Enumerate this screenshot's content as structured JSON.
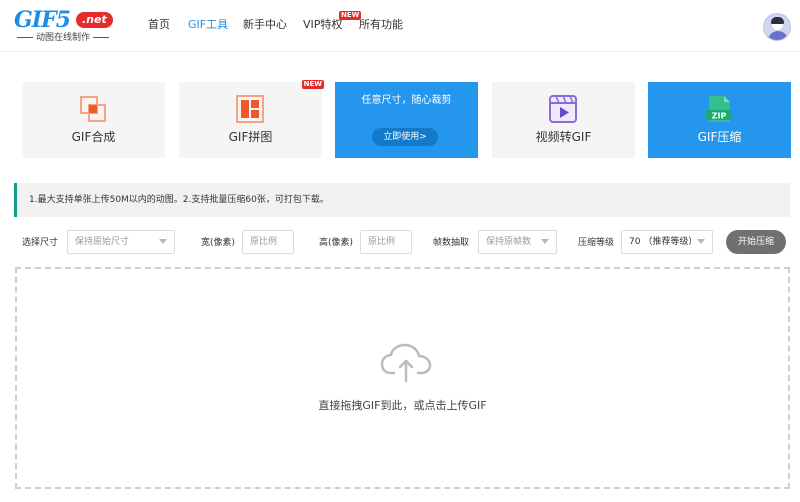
{
  "header": {
    "logo_main": "GIF5",
    "logo_net": ".net",
    "logo_sub": "动图在线制作",
    "nav": [
      {
        "label": "首页"
      },
      {
        "label": "GIF工具"
      },
      {
        "label": "新手中心"
      },
      {
        "label": "VIP特权",
        "badge": "NEW"
      },
      {
        "label": "所有功能"
      }
    ]
  },
  "tools": [
    {
      "label": "GIF合成"
    },
    {
      "label": "GIF拼图",
      "badge": "NEW"
    },
    {
      "promo_text": "任意尺寸，随心裁剪",
      "promo_button": "立即使用>"
    },
    {
      "label": "视频转GIF"
    },
    {
      "label": "GIF压缩",
      "icon_text": "ZIP"
    }
  ],
  "notice": "1.最大支持单张上传50M以内的动图。2.支持批量压缩60张，可打包下载。",
  "options": {
    "size_label": "选择尺寸",
    "size_value": "保持原始尺寸",
    "width_label": "宽(像素)",
    "width_placeholder": "原比例",
    "height_label": "高(像素)",
    "height_placeholder": "原比例",
    "frame_label": "帧数抽取",
    "frame_value": "保持原帧数",
    "level_label": "压缩等级",
    "level_value": "70 （推荐等级）",
    "start_button": "开始压缩"
  },
  "dropzone": {
    "text": "直接拖拽GIF到此，或点击上传GIF"
  },
  "colors": {
    "brand": "#1c8ee8",
    "accent_blue": "#2596ee",
    "badge_red": "#e52c2c",
    "notice_bar": "#129e8e"
  }
}
